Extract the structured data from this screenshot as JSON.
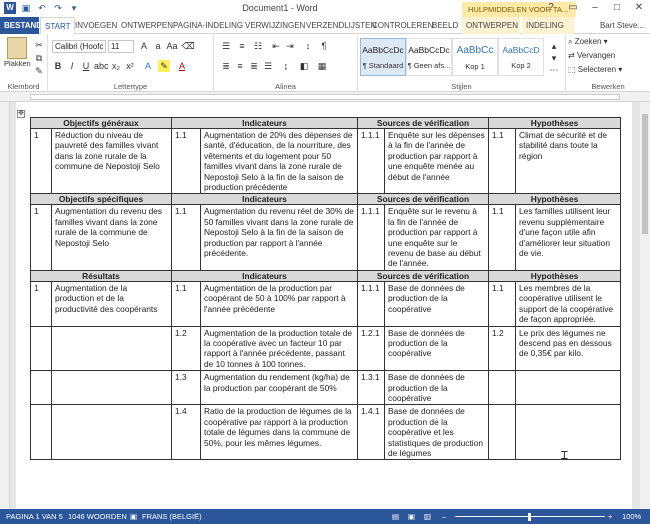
{
  "window": {
    "title": "Document1 - Word",
    "context_header": "HULPMIDDELEN VOOR TA..."
  },
  "qat": {
    "save_icon": "save-icon",
    "undo_icon": "undo-icon",
    "redo_icon": "redo-icon"
  },
  "tabs": [
    "BESTAND",
    "START",
    "INVOEGEN",
    "ONTWERPEN",
    "PAGINA-INDELING",
    "VERWIJZINGEN",
    "VERZENDLIJSTEN",
    "CONTROLEREN",
    "BEELD",
    "ONTWERPEN",
    "INDELING"
  ],
  "user": "Bart Steve...",
  "ribbon": {
    "clipboard": {
      "label": "Klembord",
      "paste": "Plakken"
    },
    "font": {
      "label": "Lettertype",
      "name": "Calibri (Hoofc",
      "size": "11"
    },
    "paragraph": {
      "label": "Alinea"
    },
    "styles": {
      "label": "Stijlen",
      "items": [
        {
          "sample": "AaBbCcDc",
          "name": "¶ Standaard"
        },
        {
          "sample": "AaBbCcDc",
          "name": "¶ Geen afs..."
        },
        {
          "sample": "AaBbCc",
          "name": "Kop 1"
        },
        {
          "sample": "AaBbCcD",
          "name": "Kop 2"
        }
      ]
    },
    "editing": {
      "label": "Bewerken",
      "find": "Zoeken",
      "replace": "Vervangen",
      "select": "Selecteren"
    }
  },
  "table": {
    "sections": [
      {
        "headers": [
          "Objectifs généraux",
          "Indicateurs",
          "Sources de vérification",
          "Hypothèses"
        ],
        "rows": [
          [
            "1",
            "Réduction du niveau de pauvreté des familles vivant dans la zone rurale de la commune de Nepostoji Selo",
            "1.1",
            "Augmentation de 20% des dépenses de santé, d'éducation, de la nourriture, des vêtements et du logement pour 50 familles vivant dans la zone rurale de Nepostoji Selo à la fin de la saison de production précédente",
            "1.1.1",
            "Enquête sur les dépenses à la fin de l'année de production par rapport à une enquête menée au début de l'année",
            "1.1",
            "Climat de sécurité et de stabilité dans toute la région"
          ]
        ]
      },
      {
        "headers": [
          "Objectifs spécifiques",
          "Indicateurs",
          "Sources de vérification",
          "Hypothèses"
        ],
        "rows": [
          [
            "1",
            "Augmentation du revenu des familles vivant dans la zone rurale de la commune de Nepostoji Selo",
            "1.1",
            "Augmentation du revenu réel de 30% de 50 familles vivant dans la zone rurale de Nepostoji Selo à la fin de la saison de production par rapport à l'année précédente.",
            "1.1.1",
            "Enquête sur le revenu à la fin de l'année de production par rapport à une enquête sur le revenu de base au début de l'année.",
            "1.1",
            "Les familles utilisent leur revenu supplémentaire d'une façon utile afin d'améliorer leur situation de vie."
          ]
        ]
      },
      {
        "headers": [
          "Résultats",
          "Indicateurs",
          "Sources de vérification",
          "Hypothèses"
        ],
        "rows": [
          [
            "1",
            "Augmentation de la production et de la productivité des coopérants",
            "1.1",
            "Augmentation de la production par coopérant de 50 à 100% par rapport à l'année précédente",
            "1.1.1",
            "Base de données de production de la coopérative",
            "1.1",
            "Les membres de la coopérative utilisent le support de la coopérative de façon appropriée."
          ],
          [
            "",
            "",
            "1.2",
            "Augmentation de la production totale de la coopérative avec un facteur 10 par rapport à l'année précédente, passant de 10 tonnes à 100 tonnes.",
            "1.2.1",
            "Base de données de production de la coopérative",
            "1.2",
            "Le prix des légumes ne descend pas en dessous de 0,35€ par kilo."
          ],
          [
            "",
            "",
            "1.3",
            "Augmentation du rendement (kg/ha) de la production par coopérant de 50%",
            "1.3.1",
            "Base de données de production de la coopérative",
            "",
            ""
          ],
          [
            "",
            "",
            "1.4",
            "Ratio de la production de légumes de la coopérative par rapport à la production totale de légumes dans la commune de 50%, pour les mêmes légumes.",
            "1.4.1",
            "Base de données de production de la coopérative et les statistiques de production de légumes",
            "",
            ""
          ]
        ]
      }
    ]
  },
  "status": {
    "page": "PAGINA 1 VAN 5",
    "words": "1046 WOORDEN",
    "language": "FRANS (BELGIË)",
    "zoom": "100%"
  }
}
